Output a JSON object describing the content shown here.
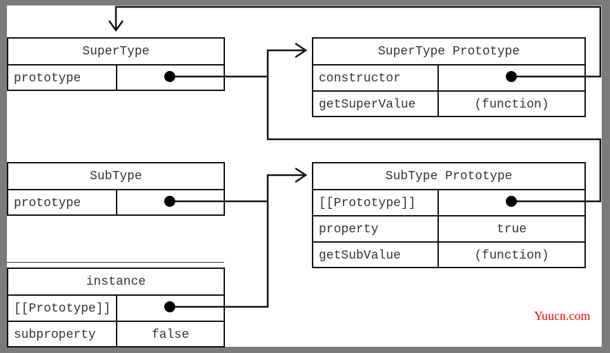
{
  "boxes": {
    "supertype": {
      "title": "SuperType",
      "rows": [
        {
          "key": "prototype",
          "value": ""
        }
      ]
    },
    "supertype_prototype": {
      "title": "SuperType Prototype",
      "rows": [
        {
          "key": "constructor",
          "value": ""
        },
        {
          "key": "getSuperValue",
          "value": "(function)"
        }
      ]
    },
    "subtype": {
      "title": "SubType",
      "rows": [
        {
          "key": "prototype",
          "value": ""
        }
      ]
    },
    "subtype_prototype": {
      "title": "SubType Prototype",
      "rows": [
        {
          "key": "[[Prototype]]",
          "value": ""
        },
        {
          "key": "property",
          "value": "true"
        },
        {
          "key": "getSubValue",
          "value": "(function)"
        }
      ]
    },
    "instance": {
      "title": "instance",
      "rows": [
        {
          "key": "[[Prototype]]",
          "value": ""
        },
        {
          "key": "subproperty",
          "value": "false"
        }
      ]
    }
  },
  "watermark": "Yuucn.com",
  "colors": {
    "line": "#111111",
    "watermark": "#ff0000",
    "background": "#7b7b7b"
  }
}
